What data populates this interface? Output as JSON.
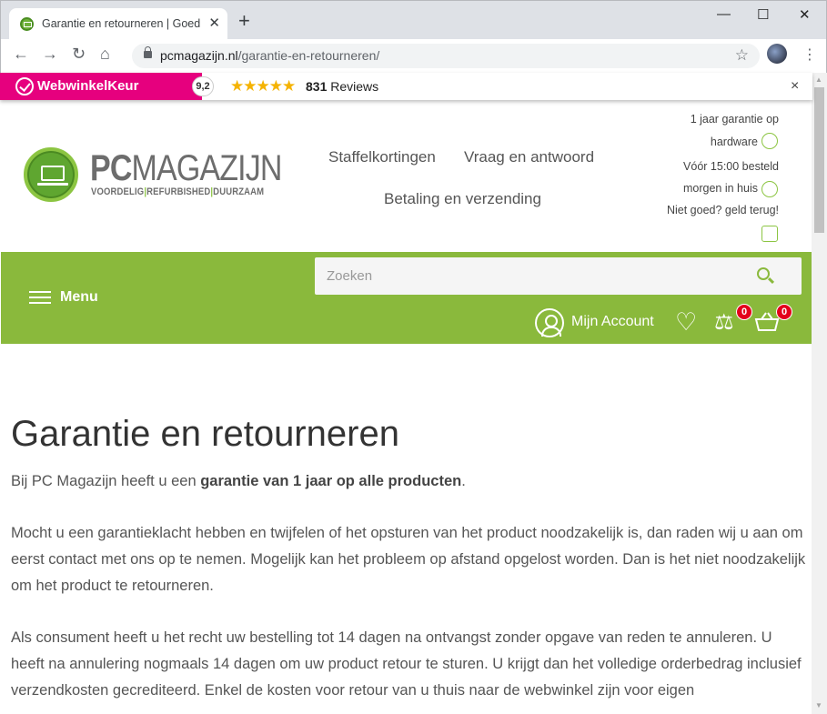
{
  "browser": {
    "tab_title": "Garantie en retourneren | Goed g",
    "tab_close": "✕",
    "new_tab": "+",
    "url_domain": "pcmagazijn.nl",
    "url_path": "/garantie-en-retourneren/",
    "window_controls": [
      "—",
      "☐",
      "✕"
    ]
  },
  "wwk": {
    "brand": "WebwinkelKeur",
    "score": "9,2",
    "stars": "★★★★★",
    "review_count": "831",
    "review_label": "Reviews",
    "close": "×"
  },
  "header": {
    "logo_pc": "PC",
    "logo_rest": "MAGAZIJN",
    "tag_1": "VOORDELIG",
    "tag_2": "REFURBISHED",
    "tag_3": "DUURZAAM",
    "tag_sep": "|",
    "nav": [
      "Staffelkortingen",
      "Vraag en antwoord",
      "Betaling en verzending"
    ],
    "usps": [
      "1 jaar garantie op",
      "hardware",
      "Vóór 15:00 besteld",
      "morgen in huis",
      "Niet goed? geld terug!"
    ]
  },
  "greenbar": {
    "menu": "Menu",
    "search_placeholder": "Zoeken",
    "account": "Mijn Account",
    "compare_count": "0",
    "cart_count": "0"
  },
  "content": {
    "title": "Garantie en retourneren",
    "p1_pre": "Bij PC Magazijn heeft u een ",
    "p1_bold": "garantie van 1 jaar op alle producten",
    "p1_post": ".",
    "p2": "Mocht u een garantieklacht hebben en twijfelen of het opsturen van het product noodzakelijk is, dan raden wij u aan om eerst contact met ons op te nemen. Mogelijk kan het probleem op afstand opgelost worden. Dan is het niet noodzakelijk om het product te retourneren.",
    "p3": "Als consument heeft u het recht uw bestelling tot 14 dagen na ontvangst zonder opgave van reden te annuleren. U heeft na annulering nogmaals 14 dagen om uw product retour te sturen. U krijgt dan het volledige orderbedrag inclusief verzendkosten gecrediteerd. Enkel de kosten voor retour van u thuis naar de webwinkel zijn voor eigen"
  },
  "colors": {
    "brand_green": "#8ab93c",
    "wwk_pink": "#e6007e",
    "badge_red": "#e3001b"
  }
}
